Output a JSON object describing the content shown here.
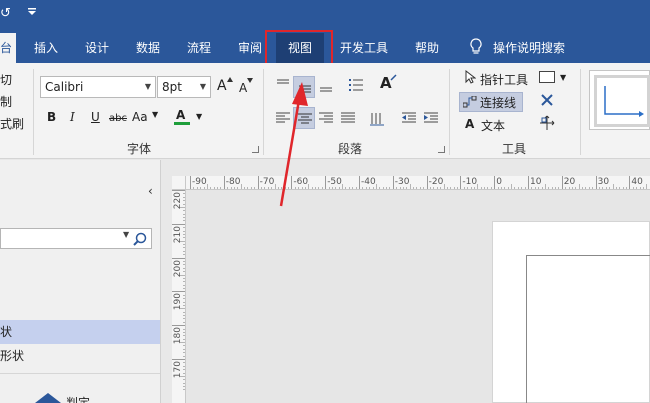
{
  "titlebar": {
    "undo_glyph": "↺",
    "qa_glyph": "₹"
  },
  "tabs": [
    {
      "label": "台"
    },
    {
      "label": "插入"
    },
    {
      "label": "设计"
    },
    {
      "label": "数据"
    },
    {
      "label": "流程"
    },
    {
      "label": "审阅"
    },
    {
      "label": "视图"
    },
    {
      "label": "开发工具"
    },
    {
      "label": "帮助"
    },
    {
      "label": "操作说明搜索"
    }
  ],
  "clipboard": {
    "items": [
      "切",
      "制",
      "式刷"
    ]
  },
  "font_group": {
    "label": "字体",
    "font_name": "Calibri",
    "font_size": "8pt",
    "grow_label": "A",
    "shrink_label": "A",
    "bold": "B",
    "italic": "I",
    "underline": "U",
    "strike": "abc",
    "case": "Aa",
    "font_color_label": "A",
    "font_color": "#1e9e3a"
  },
  "paragraph_group": {
    "label": "段落",
    "style_label": "A"
  },
  "tools_group": {
    "label": "工具",
    "pointer": "指针工具",
    "connector": "连接线",
    "text": "文本",
    "text_glyph": "A"
  },
  "left_pane": {
    "collapse_glyph": "‹",
    "search_placeholder": "",
    "items": [
      "状",
      "形状"
    ],
    "shape_label": "判定"
  },
  "ruler": {
    "h_ticks": [
      "-90",
      "-80",
      "-70",
      "-60",
      "-50",
      "-40",
      "-30",
      "-20",
      "-10",
      "0",
      "10",
      "20",
      "30",
      "40"
    ],
    "v_ticks": [
      "220",
      "210",
      "200",
      "190",
      "180",
      "170"
    ]
  },
  "colors": {
    "brand": "#2b579a",
    "highlight": "#e0262b",
    "selected": "#c5cde0"
  }
}
